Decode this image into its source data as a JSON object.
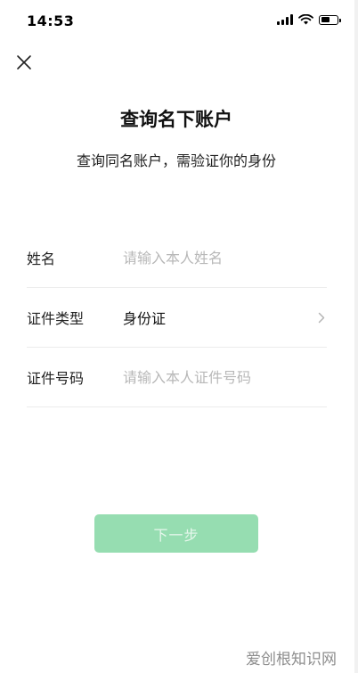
{
  "status_bar": {
    "time": "14:53"
  },
  "header": {
    "title": "查询名下账户",
    "subtitle": "查询同名账户，需验证你的身份"
  },
  "form": {
    "name": {
      "label": "姓名",
      "placeholder": "请输入本人姓名"
    },
    "id_type": {
      "label": "证件类型",
      "value": "身份证"
    },
    "id_number": {
      "label": "证件号码",
      "placeholder": "请输入本人证件号码"
    }
  },
  "next_button": {
    "label": "下一步",
    "enabled": false,
    "color": "#96ddb1"
  },
  "watermark": {
    "text": "爱创根知识网"
  },
  "icons": {
    "close": "close-icon",
    "chevron": "chevron-right-icon"
  }
}
